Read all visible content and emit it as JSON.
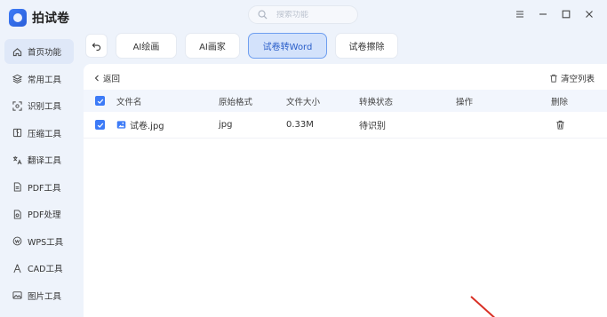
{
  "app": {
    "name": "拍试卷"
  },
  "search": {
    "placeholder": "搜索功能"
  },
  "sidebar": {
    "items": [
      {
        "label": "首页功能",
        "icon": "home-icon"
      },
      {
        "label": "常用工具",
        "icon": "layers-icon"
      },
      {
        "label": "识别工具",
        "icon": "scan-icon"
      },
      {
        "label": "压缩工具",
        "icon": "compress-icon"
      },
      {
        "label": "翻译工具",
        "icon": "translate-icon"
      },
      {
        "label": "PDF工具",
        "icon": "pdf-icon"
      },
      {
        "label": "PDF处理",
        "icon": "pdf-process-icon"
      },
      {
        "label": "WPS工具",
        "icon": "wps-icon"
      },
      {
        "label": "CAD工具",
        "icon": "cad-icon"
      },
      {
        "label": "图片工具",
        "icon": "image-icon"
      }
    ]
  },
  "tabs": [
    {
      "label": "AI绘画"
    },
    {
      "label": "AI画家"
    },
    {
      "label": "试卷转Word"
    },
    {
      "label": "试卷擦除"
    }
  ],
  "panel": {
    "back_label": "返回",
    "clear_label": "清空列表"
  },
  "table": {
    "headers": [
      "文件名",
      "原始格式",
      "文件大小",
      "转换状态",
      "操作",
      "删除"
    ],
    "rows": [
      {
        "name": "试卷.jpg",
        "format": "jpg",
        "size": "0.33M",
        "status": "待识别"
      }
    ]
  },
  "colors": {
    "accent": "#3d7bf7",
    "active_tab_bg": "#d3e2fb"
  }
}
